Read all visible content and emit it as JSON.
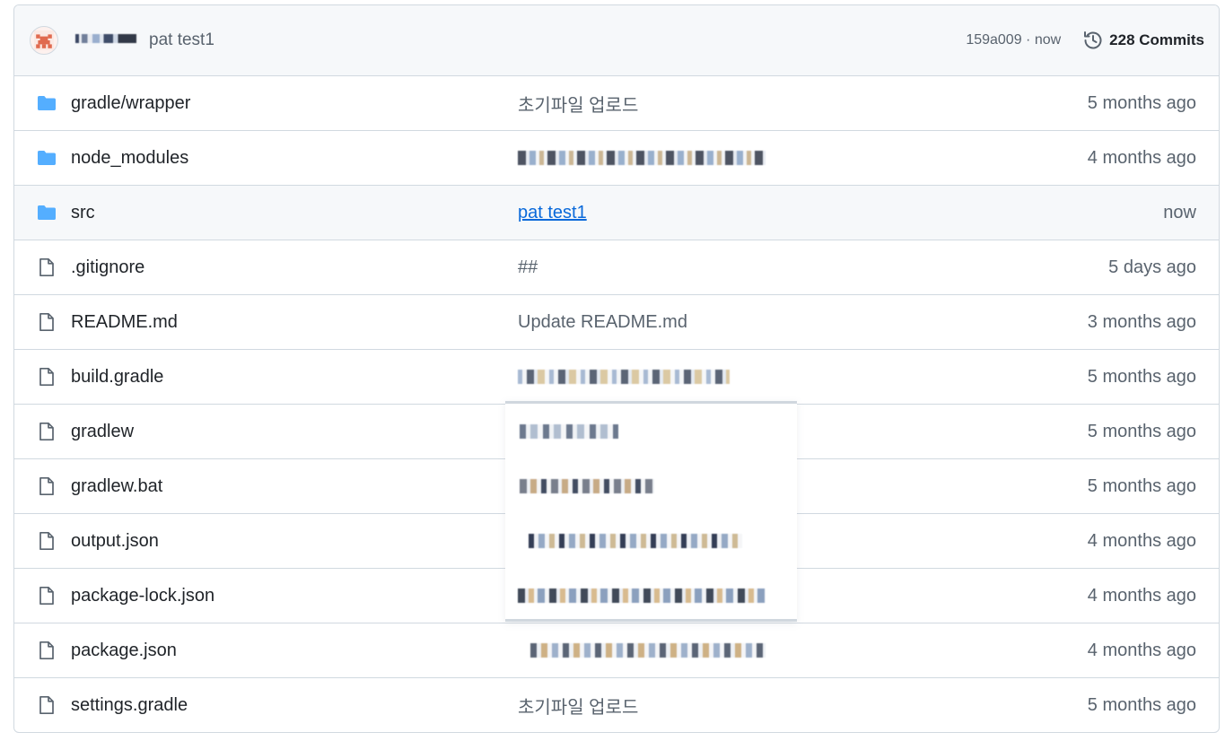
{
  "header": {
    "commit_message": "pat test1",
    "sha_time": "159a009 · now",
    "commits_label": "228 Commits"
  },
  "files": [
    {
      "type": "folder",
      "name": "gradle/wrapper",
      "message": "초기파일 업로드",
      "age": "5 months ago"
    },
    {
      "type": "folder",
      "name": "node_modules",
      "message": "",
      "age": "4 months ago"
    },
    {
      "type": "folder",
      "name": "src",
      "message": "pat test1",
      "age": "now"
    },
    {
      "type": "file",
      "name": ".gitignore",
      "message": "##",
      "age": "5 days ago"
    },
    {
      "type": "file",
      "name": "README.md",
      "message": "Update README.md",
      "age": "3 months ago"
    },
    {
      "type": "file",
      "name": "build.gradle",
      "message": "",
      "age": "5 months ago"
    },
    {
      "type": "file",
      "name": "gradlew",
      "message": "",
      "age": "5 months ago"
    },
    {
      "type": "file",
      "name": "gradlew.bat",
      "message": "",
      "age": "5 months ago"
    },
    {
      "type": "file",
      "name": "output.json",
      "message": "",
      "age": "4 months ago"
    },
    {
      "type": "file",
      "name": "package-lock.json",
      "message": "",
      "age": "4 months ago"
    },
    {
      "type": "file",
      "name": "package.json",
      "message": "",
      "age": "4 months ago"
    },
    {
      "type": "file",
      "name": "settings.gradle",
      "message": "초기파일 업로드",
      "age": "5 months ago"
    }
  ],
  "colors": {
    "folder_icon": "#54aeff",
    "file_icon": "#59636e",
    "link": "#0969da",
    "muted_text": "#59636e",
    "border": "#d1d9e0"
  },
  "icons": {
    "folder": "folder-icon",
    "file": "file-icon",
    "history": "history-icon",
    "avatar": "avatar"
  }
}
